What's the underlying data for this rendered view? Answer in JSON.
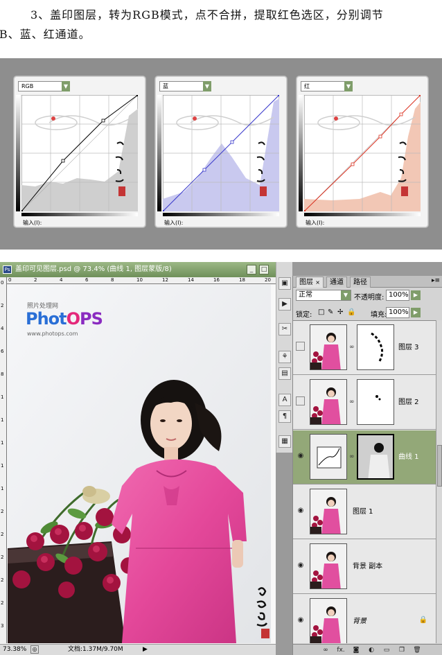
{
  "instruction": {
    "line1": "3、盖印图层，转为RGB模式，点不合拼，提取红色选区，分别调节",
    "line2": "RGB、蓝、红通道。"
  },
  "curves": [
    {
      "channel": "RGB",
      "input_label": "输入(I):",
      "color": "#000000",
      "fill": "#cfcfcf"
    },
    {
      "channel": "蓝",
      "input_label": "输入(I):",
      "color": "#3a3acc",
      "fill": "#c9c9ef"
    },
    {
      "channel": "红",
      "input_label": "输入(I):",
      "color": "#dd3322",
      "fill": "#f2c7b5"
    }
  ],
  "document": {
    "title": "盖印可见图层.psd @ 73.4% (曲线 1, 图层蒙版/8)",
    "icon_label": "Ps",
    "zoom": "73.38%",
    "doc_size": "文档:1.37M/9.70M"
  },
  "watermark": {
    "small": "照片处理网",
    "brand_a": "Phot",
    "brand_b": "O",
    "brand_c": "PS",
    "url": "www.photops.com"
  },
  "ruler": {
    "top": [
      "0",
      "2",
      "4",
      "6",
      "8",
      "10",
      "12",
      "14",
      "16",
      "18",
      "20"
    ],
    "left": [
      "0",
      "2",
      "4",
      "6",
      "8",
      "1",
      "1",
      "1",
      "1",
      "1",
      "2",
      "2",
      "2",
      "2",
      "2",
      "3"
    ]
  },
  "tools": [
    "▣",
    "▶",
    "✂",
    "⚘",
    "▤",
    "A",
    "¶",
    "▦"
  ],
  "layers_panel": {
    "tabs": [
      "图层",
      "通道",
      "路径"
    ],
    "blend_mode": "正常",
    "opacity_label": "不透明度:",
    "opacity_value": "100%",
    "lock_label": "锁定:",
    "fill_label": "填充:",
    "fill_value": "100%",
    "layers": [
      {
        "name": "图层 3",
        "visible": false,
        "has_mask": true,
        "italic": false,
        "selected": false
      },
      {
        "name": "图层 2",
        "visible": false,
        "has_mask": true,
        "italic": false,
        "selected": false
      },
      {
        "name": "曲线 1",
        "visible": true,
        "has_mask": true,
        "italic": false,
        "selected": true,
        "adjustment": true
      },
      {
        "name": "图层 1",
        "visible": true,
        "has_mask": false,
        "italic": false,
        "selected": false
      },
      {
        "name": "背景 副本",
        "visible": true,
        "has_mask": false,
        "italic": false,
        "selected": false
      },
      {
        "name": "背景",
        "visible": true,
        "has_mask": false,
        "italic": true,
        "selected": false,
        "locked": true
      }
    ],
    "bottom_icons": [
      "link-icon",
      "fx-icon",
      "mask-icon",
      "adjustment-icon",
      "folder-icon",
      "new-layer-icon",
      "trash-icon"
    ],
    "fx_label": "fx."
  }
}
